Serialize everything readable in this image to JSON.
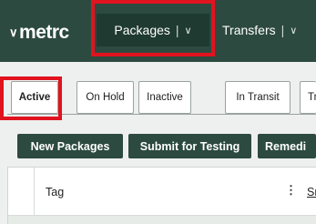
{
  "brand": {
    "name": "metrc",
    "mark": "∨"
  },
  "topnav": {
    "packages": {
      "label": "Packages",
      "separator": "|",
      "chevron": "∨"
    },
    "transfers": {
      "label": "Transfers",
      "separator": "|",
      "chevron": "∨"
    }
  },
  "tabs": [
    {
      "label": "Active"
    },
    {
      "label": "On Hold"
    },
    {
      "label": "Inactive"
    },
    {
      "label": "In Transit"
    },
    {
      "label": "Tr"
    }
  ],
  "actions": [
    {
      "label": "New Packages"
    },
    {
      "label": "Submit for Testing"
    },
    {
      "label": "Remedi"
    }
  ],
  "grid": {
    "columns": [
      {
        "label": "Tag",
        "menu": "⋮"
      },
      {
        "label": "Sr"
      }
    ]
  },
  "colors": {
    "header_bg": "#2c4a3f",
    "active_nav_bg": "#1f3a31",
    "highlight_box": "#e0131e"
  }
}
